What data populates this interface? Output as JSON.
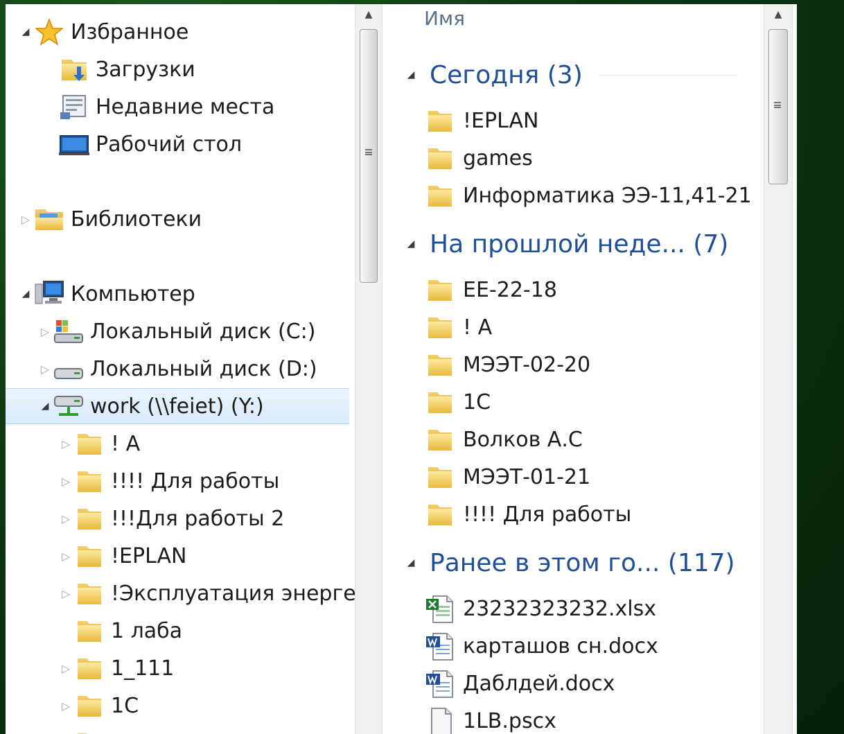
{
  "nav": {
    "favorites": {
      "label": "Избранное",
      "items": [
        "Загрузки",
        "Недавние места",
        "Рабочий стол"
      ]
    },
    "libraries": {
      "label": "Библиотеки"
    },
    "computer": {
      "label": "Компьютер",
      "drives": [
        "Локальный диск (C:)",
        "Локальный диск (D:)"
      ],
      "network": {
        "label": "work (\\\\feiet) (Y:)",
        "selected": true
      },
      "folders": [
        "! A",
        "!!!! Для работы",
        "!!!Для работы 2",
        "!EPLAN",
        "!Эксплуатация энергетического оборудования",
        "1 лаба",
        "1_111",
        "1С"
      ]
    }
  },
  "content": {
    "column_header": "Имя",
    "groups": [
      {
        "title": "Сегодня (3)",
        "items": [
          "!EPLAN",
          "games",
          "Информатика ЭЭ-11,41-21"
        ]
      },
      {
        "title": "На прошлой неде... (7)",
        "items": [
          "ЕЕ-22-18",
          "! А",
          "МЭЭТ-02-20",
          "1С",
          "Волков А.С",
          "МЭЭТ-01-21",
          "!!!! Для работы"
        ]
      },
      {
        "title": "Ранее в этом го... (117)",
        "items": [
          {
            "name": "23232323232.xlsx",
            "type": "excel"
          },
          {
            "name": "карташов сн.docx",
            "type": "word"
          },
          {
            "name": "Даблдей.docx",
            "type": "word"
          },
          {
            "name": "1LB.pscx",
            "type": "generic"
          }
        ]
      }
    ]
  },
  "colors": {
    "group_title": "#1e4f99",
    "selection": "#d7eafb",
    "folder": "#f2c94c"
  }
}
